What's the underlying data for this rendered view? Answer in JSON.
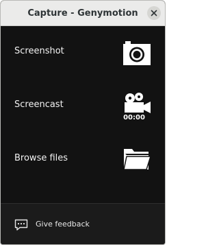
{
  "window": {
    "title": "Capture - Genymotion"
  },
  "actions": [
    {
      "label": "Screenshot",
      "icon": "camera-icon"
    },
    {
      "label": "Screencast",
      "icon": "video-camera-icon",
      "timer": "00:00"
    },
    {
      "label": "Browse files",
      "icon": "folder-icon"
    }
  ],
  "footer": {
    "label": "Give feedback",
    "icon": "feedback-icon"
  },
  "colors": {
    "titlebar": "#ebebea",
    "panel": "#121212",
    "footer": "#1b1b1b",
    "text": "#f2f2f2"
  }
}
